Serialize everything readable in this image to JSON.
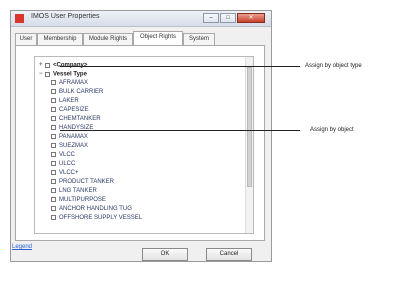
{
  "window": {
    "title": "IMOS User Properties",
    "controls": [
      "–",
      "□",
      "✕"
    ]
  },
  "tabs": [
    {
      "label": "User"
    },
    {
      "label": "Membership"
    },
    {
      "label": "Module Rights"
    },
    {
      "label": "Object Rights"
    },
    {
      "label": "System"
    }
  ],
  "tree": {
    "rows": [
      {
        "label": "<Company>",
        "bold": true,
        "expander": "+"
      },
      {
        "label": "Vessel Type",
        "bold": true,
        "expander": "−"
      },
      {
        "label": "AFRAMAX"
      },
      {
        "label": "BULK CARRIER"
      },
      {
        "label": "LAKER"
      },
      {
        "label": "CAPESIZE"
      },
      {
        "label": "CHEMTANKER"
      },
      {
        "label": "HANDYSIZE"
      },
      {
        "label": "PANAMAX"
      },
      {
        "label": "SUEZMAX"
      },
      {
        "label": "VLCC"
      },
      {
        "label": "ULCC"
      },
      {
        "label": "VLCC+"
      },
      {
        "label": "PRODUCT TANKER"
      },
      {
        "label": "LNG TANKER"
      },
      {
        "label": "MULTIPURPOSE"
      },
      {
        "label": "ANCHOR HANDLING TUG"
      },
      {
        "label": "OFFSHORE SUPPLY VESSEL"
      }
    ]
  },
  "footer": {
    "legend_link": "Legend",
    "ok_label": "OK",
    "cancel_label": "Cancel"
  },
  "annotations": {
    "by_object_type": "Assign by object type",
    "by_object": "Assign by object"
  }
}
